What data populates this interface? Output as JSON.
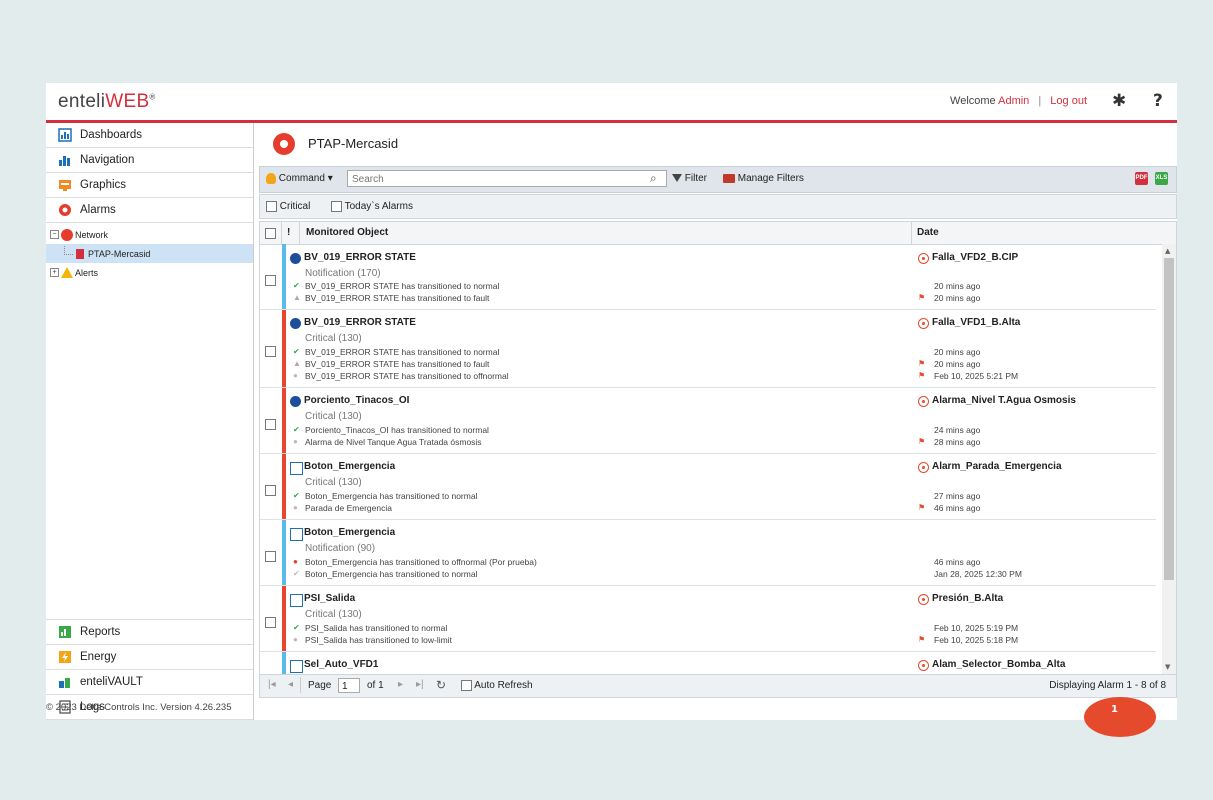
{
  "header": {
    "logo_enteli": "enteli",
    "logo_web": "WEB",
    "logo_reg": "®",
    "welcome": "Welcome",
    "user": "Admin",
    "separator": "|",
    "logout": "Log out",
    "settings_glyph": "✱",
    "help_glyph": "?"
  },
  "sidebar": {
    "top": [
      {
        "label": "Dashboards",
        "icon": "dashboards-icon"
      },
      {
        "label": "Navigation",
        "icon": "navigation-icon"
      },
      {
        "label": "Graphics",
        "icon": "graphics-icon"
      },
      {
        "label": "Alarms",
        "icon": "alarms-icon"
      }
    ],
    "tree": {
      "network": "Network",
      "selected": "PTAP-Mercasid",
      "alerts": "Alerts"
    },
    "bottom": [
      {
        "label": "Reports",
        "icon": "reports-icon"
      },
      {
        "label": "Energy",
        "icon": "energy-icon"
      },
      {
        "label": "enteliVAULT",
        "icon": "vault-icon"
      },
      {
        "label": "Logs",
        "icon": "logs-icon"
      }
    ]
  },
  "footer": "© 2023 Delta Controls Inc. Version 4.26.235",
  "main": {
    "title": "PTAP-Mercasid",
    "toolbar": {
      "command": "Command ▾",
      "search_placeholder": "Search",
      "filter": "Filter",
      "manage_filters": "Manage Filters",
      "pdf": "PDF",
      "xls": "XLS"
    },
    "filters": {
      "critical": "Critical",
      "todays": "Today`s Alarms"
    },
    "columns": {
      "priority": "!",
      "object": "Monitored Object",
      "date": "Date"
    },
    "rows": [
      {
        "object": "BV_019_ERROR STATE",
        "kind": "Notification (170)",
        "alarm": "Falla_VFD2_B.CIP",
        "events": [
          {
            "text": "BV_019_ERROR STATE has transitioned to normal",
            "time": "20 mins ago"
          },
          {
            "text": "BV_019_ERROR STATE has transitioned to fault",
            "time": "20 mins ago"
          }
        ]
      },
      {
        "object": "BV_019_ERROR STATE",
        "kind": "Critical (130)",
        "alarm": "Falla_VFD1_B.Alta",
        "events": [
          {
            "text": "BV_019_ERROR STATE has transitioned to normal",
            "time": "20 mins ago"
          },
          {
            "text": "BV_019_ERROR STATE has transitioned to fault",
            "time": "20 mins ago"
          },
          {
            "text": "BV_019_ERROR STATE has transitioned to offnormal",
            "time": "Feb 10, 2025 5:21 PM"
          }
        ]
      },
      {
        "object": "Porciento_Tinacos_OI",
        "kind": "Critical (130)",
        "alarm": "Alarma_Nivel T.Agua Osmosis",
        "events": [
          {
            "text": "Porciento_Tinacos_OI has transitioned to normal",
            "time": "24 mins ago"
          },
          {
            "text": "Alarma de Nivel Tanque Agua Tratada ósmosis",
            "time": "28 mins ago"
          }
        ]
      },
      {
        "object": "Boton_Emergencia",
        "kind": "Critical (130)",
        "alarm": "Alarm_Parada_Emergencia",
        "events": [
          {
            "text": "Boton_Emergencia has transitioned to normal",
            "time": "27 mins ago"
          },
          {
            "text": "Parada de Emergencia",
            "time": "46 mins ago"
          }
        ]
      },
      {
        "object": "Boton_Emergencia",
        "kind": "Notification (90)",
        "alarm": "",
        "events": [
          {
            "text": "Boton_Emergencia has transitioned to offnormal (Por prueba)",
            "time": "46 mins ago"
          },
          {
            "text": "Boton_Emergencia has transitioned to normal",
            "time": "Jan 28, 2025 12:30 PM"
          }
        ]
      },
      {
        "object": "PSI_Salida",
        "kind": "Critical (130)",
        "alarm": "Presión_B.Alta",
        "events": [
          {
            "text": "PSI_Salida has transitioned to normal",
            "time": "Feb 10, 2025 5:19 PM"
          },
          {
            "text": "PSI_Salida has transitioned to low-limit",
            "time": "Feb 10, 2025 5:18 PM"
          }
        ]
      },
      {
        "object": "Sel_Auto_VFD1",
        "kind": "",
        "alarm": "Alam_Selector_Bomba_Alta",
        "events": []
      }
    ],
    "pager": {
      "page_label": "Page",
      "page_value": "1",
      "of_label": "of 1",
      "auto_refresh": "Auto Refresh",
      "display_info": "Displaying Alarm 1 - 8 of 8"
    }
  },
  "notification_count": "1",
  "colors": {
    "accent": "#d32f3f",
    "critical": "#e8442e",
    "notification": "#5bbbe8"
  }
}
